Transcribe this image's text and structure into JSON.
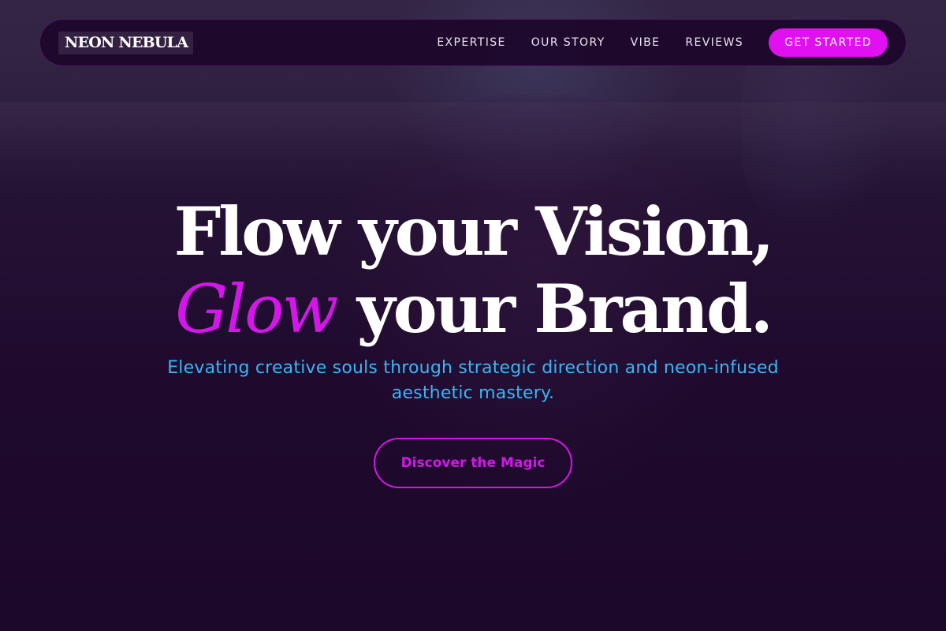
{
  "brand": {
    "logo_text": "NEON NEBULA"
  },
  "nav": {
    "links": [
      "EXPERTISE",
      "OUR STORY",
      "VIBE",
      "REVIEWS"
    ],
    "cta_label": "GET STARTED"
  },
  "hero": {
    "headline_line1": "Flow your Vision,",
    "headline_accent": "Glow",
    "headline_line2_rest": "your Brand.",
    "subtitle": "Elevating creative souls through strategic direction and neon-infused aesthetic mastery.",
    "button_label": "Discover the Magic"
  },
  "colors": {
    "background": "#1f0a2e",
    "accent_magenta": "#d516ea",
    "cta_magenta": "#e010f0",
    "subtitle_blue": "#38b6f5",
    "text_white": "#ffffff"
  }
}
